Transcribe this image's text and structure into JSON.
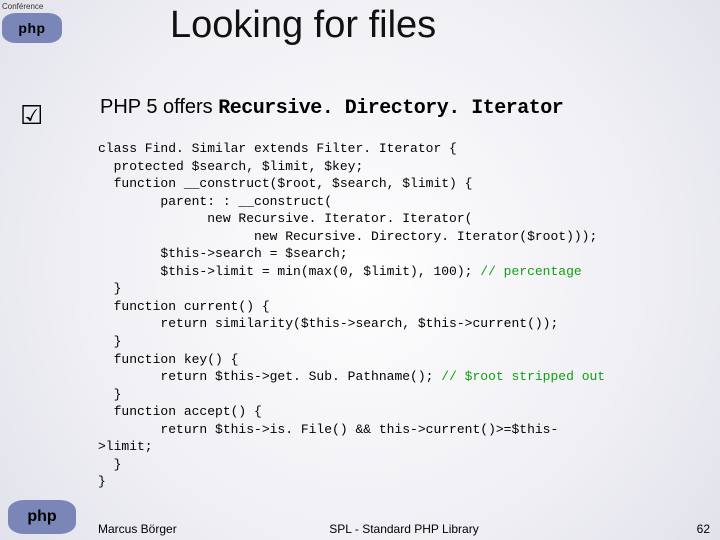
{
  "conference_label": "Conférence",
  "logo_text": "php",
  "title": "Looking for files",
  "subtitle_prefix": "PHP 5 offers ",
  "subtitle_mono": "Recursive. Directory. Iterator",
  "code": {
    "l1": "class Find. Similar extends Filter. Iterator {",
    "l2": "  protected $search, $limit, $key;",
    "l3": "  function __construct($root, $search, $limit) {",
    "l4": "        parent: : __construct(",
    "l5": "              new Recursive. Iterator. Iterator(",
    "l6": "                    new Recursive. Directory. Iterator($root)));",
    "l7": "        $this->search = $search;",
    "l8a": "        $this->limit = min(max(0, $limit), 100); ",
    "l8b": "// percentage",
    "l9": "  }",
    "l10": "  function current() {",
    "l11": "        return similarity($this->search, $this->current());",
    "l12": "  }",
    "l13": "  function key() {",
    "l14a": "        return $this->get. Sub. Pathname(); ",
    "l14b": "// $root stripped out",
    "l15": "  }",
    "l16": "  function accept() {",
    "l17": "        return $this->is. File() && this->current()>=$this-",
    "l18": ">limit;",
    "l19": "  }",
    "l20": "}"
  },
  "footer": {
    "author": "Marcus Börger",
    "library": "SPL - Standard PHP Library",
    "page": "62"
  }
}
